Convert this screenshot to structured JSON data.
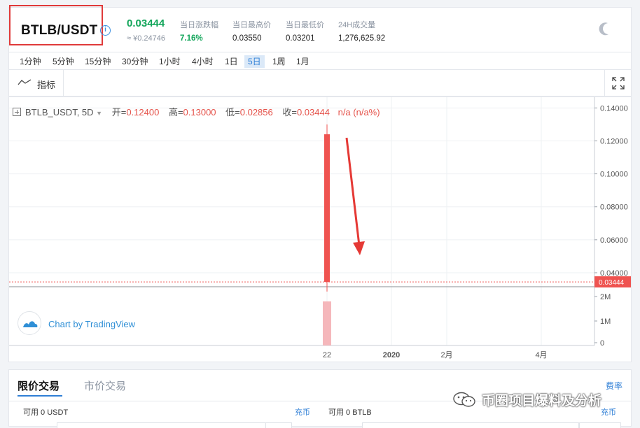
{
  "header": {
    "pair": "BTLB/USDT",
    "info_icon": "info-icon",
    "last_price": "0.03444",
    "cny_price": "≈ ¥0.24746",
    "stats": [
      {
        "label": "当日涨跌幅",
        "value": "7.16%",
        "highlight": true
      },
      {
        "label": "当日最高价",
        "value": "0.03550",
        "highlight": false
      },
      {
        "label": "当日最低价",
        "value": "0.03201",
        "highlight": false
      },
      {
        "label": "24H成交量",
        "value": "1,276,625.92",
        "highlight": false
      }
    ],
    "theme_icon": "moon-icon"
  },
  "intervals": {
    "items": [
      "1分钟",
      "5分钟",
      "15分钟",
      "30分钟",
      "1小时",
      "4小时",
      "1日",
      "5日",
      "1周",
      "1月"
    ],
    "active_index": 7
  },
  "toolbar": {
    "indicator_label": "指标",
    "indicator_icon": "indicator-wave-icon",
    "fullscreen_icon": "fullscreen-icon"
  },
  "chart_data": {
    "type": "candlestick",
    "symbol_label": "BTLB_USDT, 5D",
    "ohlc_labels": {
      "open_label": "开=",
      "open": "0.12400",
      "high_label": "高=",
      "high": "0.13000",
      "low_label": "低=",
      "low": "0.02856",
      "close_label": "收=",
      "close": "0.03444",
      "change": "n/a (n/a%)"
    },
    "candles": [
      {
        "x": "22",
        "open": 0.124,
        "high": 0.13,
        "low": 0.02856,
        "close": 0.03444,
        "volume": 1800000
      }
    ],
    "last_price_tag": "0.03444",
    "last_price": 0.03444,
    "price_axis_ticks": [
      "0.14000",
      "0.12000",
      "0.10000",
      "0.08000",
      "0.06000",
      "0.04000"
    ],
    "price_axis_values": [
      0.14,
      0.12,
      0.1,
      0.08,
      0.06,
      0.04
    ],
    "ylim": [
      0.0315,
      0.1465
    ],
    "volume_axis_ticks": [
      "2M",
      "1M",
      "0"
    ],
    "volume_axis_values": [
      2000000,
      1000000,
      0
    ],
    "vlim": [
      0,
      2200000
    ],
    "time_axis_ticks": [
      {
        "label": "22",
        "bold": false
      },
      {
        "label": "2020",
        "bold": true
      },
      {
        "label": "2月",
        "bold": false
      },
      {
        "label": "4月",
        "bold": false
      }
    ],
    "colors": {
      "down": "#ef5350",
      "volume": "#f5b7bb",
      "annotation_arrow": "#e53935",
      "grid": "#eef0f3"
    }
  },
  "branding": {
    "tradingview_label": "Chart by TradingView",
    "logo_icon": "tradingview-logo-icon"
  },
  "trade": {
    "tabs": [
      "限价交易",
      "市价交易"
    ],
    "active_tab": 0,
    "fee_label": "费率",
    "buy": {
      "available": "可用 0 USDT",
      "deposit": "充币"
    },
    "sell": {
      "available": "可用 0 BTLB",
      "deposit": "充币"
    }
  },
  "watermark": {
    "text": "币圈项目爆料及分析",
    "icon": "wechat-icon"
  }
}
